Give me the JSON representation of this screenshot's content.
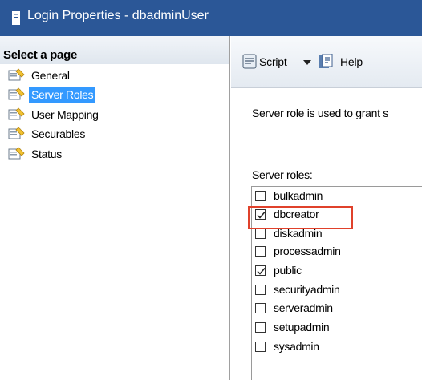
{
  "window": {
    "title": "Login Properties - dbadminUser"
  },
  "sidebar": {
    "header": "Select a page",
    "items": [
      {
        "label": "General",
        "selected": false
      },
      {
        "label": "Server Roles",
        "selected": true
      },
      {
        "label": "User Mapping",
        "selected": false
      },
      {
        "label": "Securables",
        "selected": false
      },
      {
        "label": "Status",
        "selected": false
      }
    ]
  },
  "toolbar": {
    "script_label": "Script",
    "help_label": "Help"
  },
  "main": {
    "description": "Server role is used to grant s",
    "roles_label": "Server roles:",
    "roles": [
      {
        "name": "bulkadmin",
        "checked": false
      },
      {
        "name": "dbcreator",
        "checked": true
      },
      {
        "name": "diskadmin",
        "checked": false
      },
      {
        "name": "processadmin",
        "checked": false
      },
      {
        "name": "public",
        "checked": true
      },
      {
        "name": "securityadmin",
        "checked": false
      },
      {
        "name": "serveradmin",
        "checked": false
      },
      {
        "name": "setupadmin",
        "checked": false
      },
      {
        "name": "sysadmin",
        "checked": false
      }
    ],
    "highlighted_role": "dbcreator"
  },
  "colors": {
    "titlebar": "#2b5797",
    "selection": "#3399ff",
    "highlight": "#e0412b"
  }
}
